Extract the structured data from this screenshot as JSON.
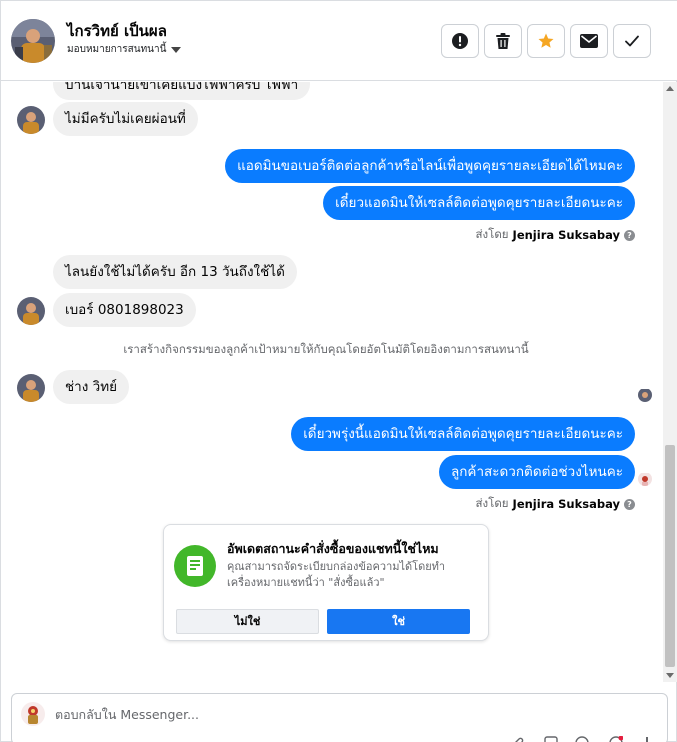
{
  "header": {
    "contact_name": "ไกรวิทย์ เป็นผล",
    "assign_label": "มอบหมายการสนทนานี้",
    "buttons": [
      {
        "name": "spam-button",
        "icon": "alert-circle-icon"
      },
      {
        "name": "delete-button",
        "icon": "trash-icon"
      },
      {
        "name": "star-button",
        "icon": "star-icon"
      },
      {
        "name": "mark-unread-button",
        "icon": "envelope-icon"
      },
      {
        "name": "done-button",
        "icon": "checkmark-icon"
      }
    ]
  },
  "messages": [
    {
      "side": "in",
      "text": "บ้านเจ้านายเขาเคยแบ่งไฟฟ้าครับ ไฟฟ้า",
      "partial": true
    },
    {
      "side": "in",
      "text": "ไม่มีครับไม่เคยผ่อนที่"
    },
    {
      "side": "out",
      "text": "แอดมินขอเบอร์ติดต่อลูกค้าหรือไลน์เพื่อพูดคุยรายละเอียดได้ไหมคะ"
    },
    {
      "side": "out",
      "text": "เดี๋ยวแอดมินให้เซลล์ติดต่อพูดคุยรายละเอียดนะคะ"
    },
    {
      "side": "in",
      "text": "ไลนยังใช้ไม่ได้ครับ อีก 13 วันถึงใช้ได้"
    },
    {
      "side": "in",
      "text": "เบอร์ 0801898023"
    },
    {
      "side": "in",
      "text": "ช่าง วิทย์"
    },
    {
      "side": "out",
      "text": "เดี๋ยวพรุ่งนี้แอดมินให้เซลล์ติดต่อพูดคุยรายละเอียดนะคะ"
    },
    {
      "side": "out",
      "text": "ลูกค้าสะดวกติดต่อช่วงไหนคะ"
    }
  ],
  "sent_by": {
    "prefix": "ส่งโดย",
    "name": "Jenjira Suksabay",
    "help_glyph": "?"
  },
  "system_note": "เราสร้างกิจกรรมของลูกค้าเป้าหมายให้กับคุณโดยอัตโนมัติโดยอิงตามการสนทนานี้",
  "order_prompt": {
    "title": "อัพเดตสถานะคำสั่งซื้อของแชทนี้ใช่ไหม",
    "description": "คุณสามารถจัดระเบียบกล่องข้อความได้โดยทำเครื่องหมายแชทนี้ว่า \"สั่งซื้อแล้ว\"",
    "no_label": "ไม่ใช่",
    "yes_label": "ใช่",
    "icon": "order-document-icon"
  },
  "composer": {
    "placeholder": "ตอบกลับใน Messenger..."
  },
  "colors": {
    "outgoing_bubble": "#0a7cff",
    "incoming_bubble": "#f0f0f0",
    "star": "#f5a623",
    "primary_button": "#1877f2",
    "order_icon_bg": "#42b72a"
  }
}
